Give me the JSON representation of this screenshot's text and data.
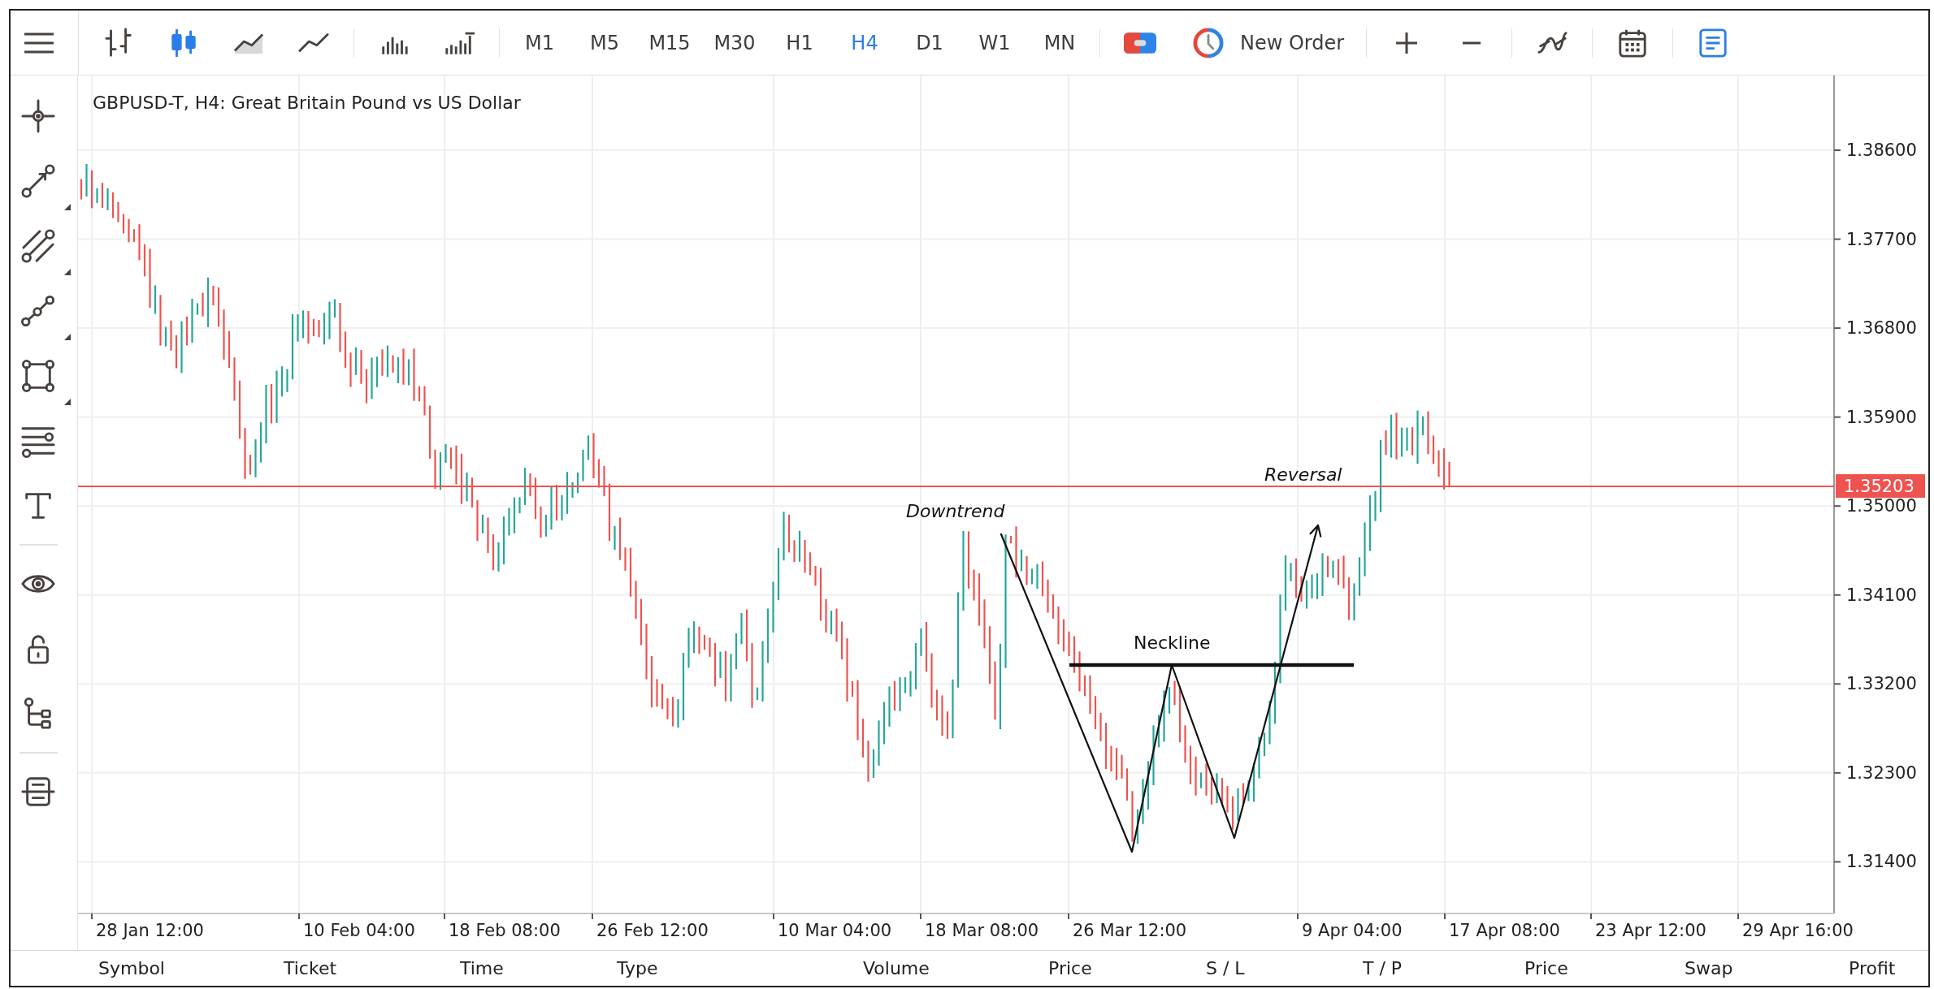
{
  "toolbar": {
    "chart_types": [
      {
        "kind": "bars",
        "selected": false
      },
      {
        "kind": "candles",
        "selected": true
      },
      {
        "kind": "area",
        "selected": false
      },
      {
        "kind": "line",
        "selected": false
      }
    ],
    "volume_types": [
      {
        "kind": "tick",
        "on": false
      },
      {
        "kind": "real",
        "on": false
      }
    ],
    "timeframes": [
      {
        "label": "M1",
        "selected": false
      },
      {
        "label": "M5",
        "selected": false
      },
      {
        "label": "M15",
        "selected": false
      },
      {
        "label": "M30",
        "selected": false
      },
      {
        "label": "H1",
        "selected": false
      },
      {
        "label": "H4",
        "selected": true
      },
      {
        "label": "D1",
        "selected": false
      },
      {
        "label": "W1",
        "selected": false
      },
      {
        "label": "MN",
        "selected": false
      }
    ],
    "new_order": {
      "label": "New Order"
    },
    "trade_panel": {
      "on": true
    }
  },
  "sidebar": {
    "groups": [
      {
        "tools": [
          {
            "kind": "crosshair",
            "submenu": false
          },
          {
            "kind": "trend-line",
            "submenu": true
          },
          {
            "kind": "channel",
            "submenu": true
          },
          {
            "kind": "polyline",
            "submenu": true
          },
          {
            "kind": "rectangle",
            "submenu": true
          },
          {
            "kind": "fibonacci",
            "submenu": false
          },
          {
            "kind": "text",
            "submenu": false
          }
        ]
      },
      {
        "tools": [
          {
            "kind": "visibility",
            "submenu": false
          },
          {
            "kind": "lock",
            "submenu": false
          },
          {
            "kind": "object-tree",
            "submenu": false
          }
        ]
      },
      {
        "tools": [
          {
            "kind": "templates",
            "submenu": false
          }
        ]
      }
    ]
  },
  "chart": {
    "title": "GBPUSD-T, H4: Great Britain Pound vs US Dollar",
    "price_labels": [
      "1.38600",
      "1.37700",
      "1.36800",
      "1.35900",
      "1.35000",
      "1.34100",
      "1.33200",
      "1.32300",
      "1.31400"
    ],
    "current_price": "1.35203",
    "time_labels": [
      "28 Jan 12:00",
      "10 Feb 04:00",
      "18 Feb 08:00",
      "26 Feb 12:00",
      "10 Mar 04:00",
      "18 Mar 08:00",
      "26 Mar 12:00",
      "9 Apr 04:00",
      "17 Apr 08:00",
      "23 Apr 12:00",
      "29 Apr 16:00"
    ],
    "annotations": [
      {
        "kind": "trend",
        "text": "Downtrend"
      },
      {
        "kind": "level",
        "text": "Neckline"
      },
      {
        "kind": "trend",
        "text": "Reversal"
      }
    ]
  },
  "trade_table": {
    "columns": [
      "Symbol",
      "Ticket",
      "Time",
      "Type",
      "Volume",
      "Price",
      "S / L",
      "T / P",
      "Price",
      "Swap",
      "Profit"
    ]
  }
}
